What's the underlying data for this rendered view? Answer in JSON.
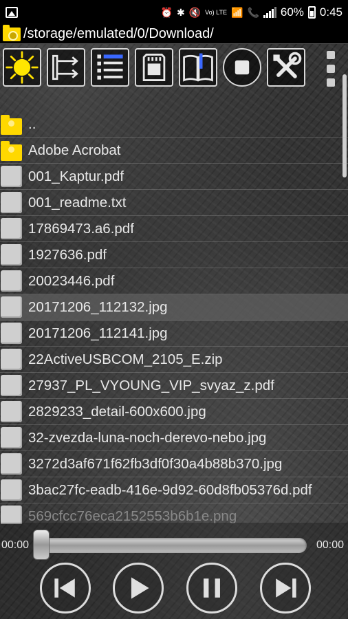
{
  "status_bar": {
    "battery": "60%",
    "time": "0:45",
    "volte_label": "Vo) LTE",
    "icons": [
      "image-icon",
      "alarm-icon",
      "bluetooth-icon",
      "mute-icon",
      "volte-icon",
      "wifi-icon",
      "call-icon",
      "signal-icon",
      "battery-icon"
    ]
  },
  "path_bar": {
    "path": "/storage/emulated/0/Download/"
  },
  "toolbar": {
    "buttons": [
      "brightness-icon",
      "transfer-icon",
      "playlist-icon",
      "sd-card-icon",
      "book-icon",
      "stop-icon",
      "tools-icon"
    ],
    "menu": "overflow-menu-icon"
  },
  "files": [
    {
      "name": "..",
      "type": "folder"
    },
    {
      "name": "Adobe Acrobat",
      "type": "folder"
    },
    {
      "name": "001_Kaptur.pdf",
      "type": "file"
    },
    {
      "name": "001_readme.txt",
      "type": "file"
    },
    {
      "name": "17869473.a6.pdf",
      "type": "file"
    },
    {
      "name": "1927636.pdf",
      "type": "file"
    },
    {
      "name": "20023446.pdf",
      "type": "file"
    },
    {
      "name": "20171206_112132.jpg",
      "type": "file",
      "selected": true
    },
    {
      "name": "20171206_112141.jpg",
      "type": "file"
    },
    {
      "name": "22ActiveUSBCOM_2105_E.zip",
      "type": "file"
    },
    {
      "name": "27937_PL_VYOUNG_VIP_svyaz_z.pdf",
      "type": "file"
    },
    {
      "name": "2829233_detail-600x600.jpg",
      "type": "file"
    },
    {
      "name": "32-zvezda-luna-noch-derevo-nebo.jpg",
      "type": "file"
    },
    {
      "name": "3272d3af671f62fb3df0f30a4b88b370.jpg",
      "type": "file"
    },
    {
      "name": "3bac27fc-eadb-416e-9d92-60d8fb05376d.pdf",
      "type": "file"
    },
    {
      "name": "569cfcc76eca2152553b6b1e.png",
      "type": "file"
    }
  ],
  "player": {
    "elapsed": "00:00",
    "duration": "00:00",
    "progress": 0,
    "controls": [
      "previous-icon",
      "play-icon",
      "pause-icon",
      "next-icon"
    ]
  }
}
